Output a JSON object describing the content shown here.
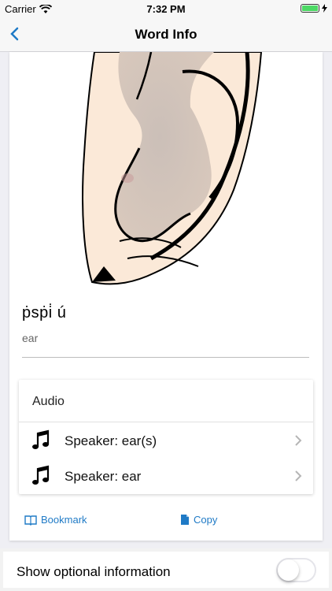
{
  "status_bar": {
    "carrier": "Carrier",
    "time": "7:32 PM",
    "battery_color": "#4cd964"
  },
  "nav": {
    "back_icon": "chevron-left-icon",
    "title": "Word Info"
  },
  "word": {
    "text": "ṗsṗi̇ ú",
    "gloss": "ear"
  },
  "audio": {
    "title": "Audio",
    "items": [
      {
        "icon": "music-note-icon",
        "label": "Speaker: ear(s)"
      },
      {
        "icon": "music-note-icon",
        "label": "Speaker: ear"
      }
    ]
  },
  "actions": {
    "bookmark_label": "Bookmark",
    "copy_label": "Copy",
    "color": "#1f7ac6"
  },
  "optional": {
    "label": "Show optional information",
    "enabled": false
  }
}
